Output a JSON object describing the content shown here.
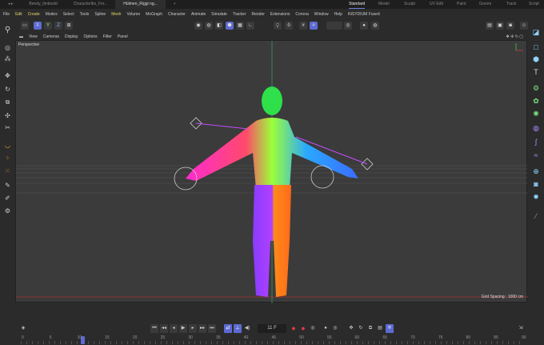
{
  "tabs": {
    "docs": [
      "Bendy_limbsold",
      "Characterlbs_For...",
      "Hülmen_Riggi ng..."
    ],
    "layouts": [
      "Standard",
      "Model",
      "Sculpt",
      "UV Edit",
      "Paint",
      "Groom",
      "Track",
      "Script"
    ]
  },
  "menu": [
    "File",
    "Edit",
    "Create",
    "Modes",
    "Select",
    "Tools",
    "Spline",
    "Mesh",
    "Volume",
    "MoGraph",
    "Character",
    "Animate",
    "Simulate",
    "Tracker",
    "Render",
    "Extensions",
    "Corona",
    "Window",
    "Help",
    "INSYDIUM Fused"
  ],
  "viewport_menu": [
    "View",
    "Cameras",
    "Display",
    "Options",
    "Filter",
    "Panel"
  ],
  "viewport": {
    "label": "Perspective",
    "grid_spacing": "Grid Spacing : 1000 cm"
  },
  "axis": {
    "x": "X",
    "y": "Y",
    "z": "Z"
  },
  "playback": {
    "current_frame": "11 F"
  },
  "timeline": {
    "ticks": [
      "0",
      "5",
      "10",
      "15",
      "20",
      "25",
      "30",
      "35",
      "40",
      "45",
      "50",
      "55",
      "60",
      "65",
      "70",
      "75",
      "80",
      "85",
      "90"
    ],
    "current": 11,
    "max": 90
  },
  "colors": {
    "accent": "#5d6ad1",
    "highlight": "#e6d96a",
    "record": "#e0394a"
  }
}
